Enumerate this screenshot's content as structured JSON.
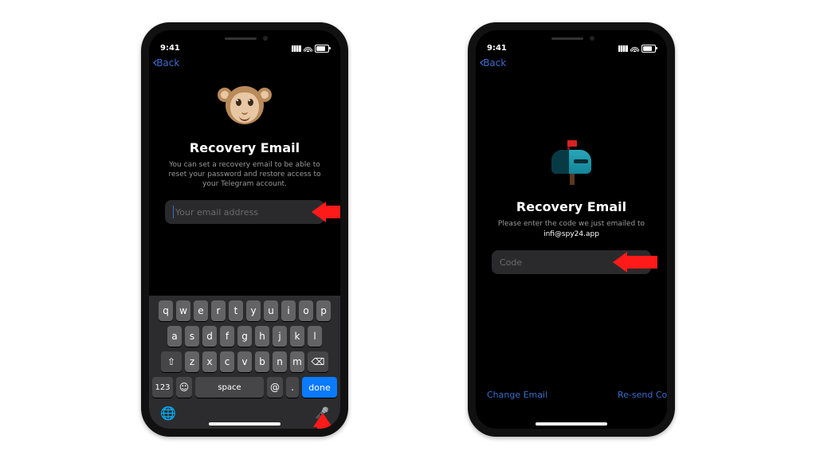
{
  "status": {
    "time": "9:41"
  },
  "nav": {
    "back": "Back"
  },
  "left": {
    "title": "Recovery Email",
    "sub": "You can set a recovery email to be able to reset your password and restore access to your Telegram account.",
    "placeholder": "Your email address"
  },
  "right": {
    "title": "Recovery Email",
    "sub": "Please enter the code we just emailed to",
    "email": "infi@spy24.app",
    "placeholder": "Code",
    "change": "Change Email",
    "resend": "Re-send Code"
  },
  "keyboard": {
    "r1": [
      "q",
      "w",
      "e",
      "r",
      "t",
      "y",
      "u",
      "i",
      "o",
      "p"
    ],
    "r2": [
      "a",
      "s",
      "d",
      "f",
      "g",
      "h",
      "j",
      "k",
      "l"
    ],
    "r3": [
      "⇧",
      "z",
      "x",
      "c",
      "v",
      "b",
      "n",
      "m",
      "⌫"
    ],
    "num": "123",
    "emoji": "☺",
    "space": "space",
    "at": "@",
    "dot": ".",
    "done": "done"
  }
}
